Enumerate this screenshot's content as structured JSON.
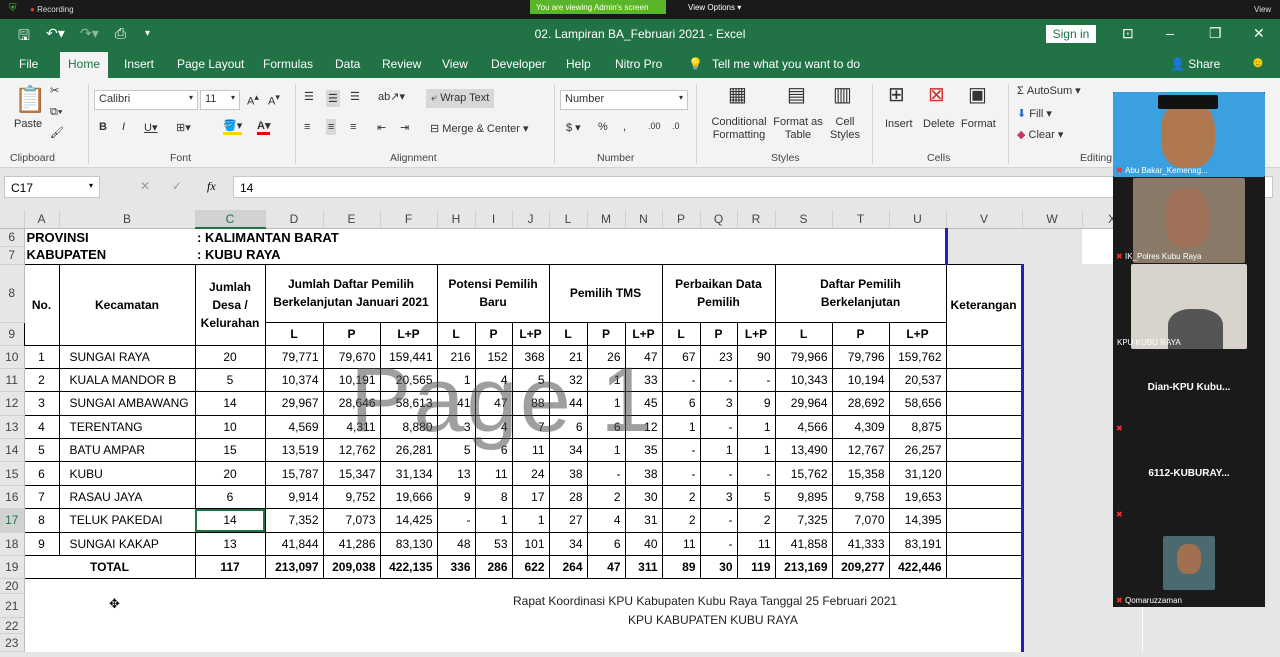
{
  "zoom": {
    "recording": "Recording",
    "viewing": "You are viewing Admin's screen",
    "view_options": "View Options",
    "view": "View"
  },
  "window": {
    "title": "02. Lampiran BA_Februari 2021  -  Excel",
    "sign_in": "Sign in"
  },
  "tabs": [
    "File",
    "Home",
    "Insert",
    "Page Layout",
    "Formulas",
    "Data",
    "Review",
    "View",
    "Developer",
    "Help",
    "Nitro Pro"
  ],
  "tell_me": "Tell me what you want to do",
  "share": "Share",
  "ribbon": {
    "paste": "Paste",
    "clipboard": "Clipboard",
    "font_name": "Calibri",
    "font_size": "11",
    "font": "Font",
    "wrap_text": "Wrap Text",
    "merge_center": "Merge & Center",
    "alignment": "Alignment",
    "number_format": "Number",
    "number": "Number",
    "conditional": "Conditional Formatting",
    "format_table": "Format as Table",
    "cell_styles": "Cell Styles",
    "styles": "Styles",
    "insert": "Insert",
    "delete": "Delete",
    "format": "Format",
    "cells": "Cells",
    "autosum": "AutoSum",
    "fill": "Fill",
    "clear": "Clear",
    "editing": "Editing"
  },
  "formula_bar": {
    "name_box": "C17",
    "value": "14"
  },
  "columns": [
    "A",
    "B",
    "C",
    "D",
    "E",
    "F",
    "H",
    "I",
    "J",
    "L",
    "M",
    "N",
    "P",
    "Q",
    "R",
    "S",
    "T",
    "U",
    "V",
    "W",
    "X"
  ],
  "selected_column": "C",
  "selected_row": "17",
  "sheet": {
    "provinsi_label": "PROVINSI",
    "provinsi_value": ": KALIMANTAN BARAT",
    "kabupaten_label": "KABUPATEN",
    "kabupaten_value": ": KUBU RAYA",
    "headers": {
      "no": "No.",
      "kecamatan": "Kecamatan",
      "jumlah_desa": "Jumlah Desa / Kelurahan",
      "dpb_jan": "Jumlah Daftar Pemilih Berkelanjutan Januari 2021",
      "potensi": "Potensi Pemilih Baru",
      "tms": "Pemilih TMS",
      "perbaikan": "Perbaikan Data Pemilih",
      "dpb": "Daftar Pemilih Berkelanjutan",
      "keterangan": "Keterangan",
      "l": "L",
      "p": "P",
      "lp": "L+P"
    },
    "rows": [
      [
        "1",
        "SUNGAI RAYA",
        "20",
        "79,771",
        "79,670",
        "159,441",
        "216",
        "152",
        "368",
        "21",
        "26",
        "47",
        "67",
        "23",
        "90",
        "79,966",
        "79,796",
        "159,762"
      ],
      [
        "2",
        "KUALA MANDOR B",
        "5",
        "10,374",
        "10,191",
        "20,565",
        "1",
        "4",
        "5",
        "32",
        "1",
        "33",
        "-",
        "-",
        "-",
        "10,343",
        "10,194",
        "20,537"
      ],
      [
        "3",
        "SUNGAI AMBAWANG",
        "14",
        "29,967",
        "28,646",
        "58,613",
        "41",
        "47",
        "88",
        "44",
        "1",
        "45",
        "6",
        "3",
        "9",
        "29,964",
        "28,692",
        "58,656"
      ],
      [
        "4",
        "TERENTANG",
        "10",
        "4,569",
        "4,311",
        "8,880",
        "3",
        "4",
        "7",
        "6",
        "6",
        "12",
        "1",
        "-",
        "1",
        "4,566",
        "4,309",
        "8,875"
      ],
      [
        "5",
        "BATU AMPAR",
        "15",
        "13,519",
        "12,762",
        "26,281",
        "5",
        "6",
        "11",
        "34",
        "1",
        "35",
        "-",
        "1",
        "1",
        "13,490",
        "12,767",
        "26,257"
      ],
      [
        "6",
        "KUBU",
        "20",
        "15,787",
        "15,347",
        "31,134",
        "13",
        "11",
        "24",
        "38",
        "-",
        "38",
        "-",
        "-",
        "-",
        "15,762",
        "15,358",
        "31,120"
      ],
      [
        "7",
        "RASAU JAYA",
        "6",
        "9,914",
        "9,752",
        "19,666",
        "9",
        "8",
        "17",
        "28",
        "2",
        "30",
        "2",
        "3",
        "5",
        "9,895",
        "9,758",
        "19,653"
      ],
      [
        "8",
        "TELUK PAKEDAI",
        "14",
        "7,352",
        "7,073",
        "14,425",
        "-",
        "1",
        "1",
        "27",
        "4",
        "31",
        "2",
        "-",
        "2",
        "7,325",
        "7,070",
        "14,395"
      ],
      [
        "9",
        "SUNGAI KAKAP",
        "13",
        "41,844",
        "41,286",
        "83,130",
        "48",
        "53",
        "101",
        "34",
        "6",
        "40",
        "11",
        "-",
        "11",
        "41,858",
        "41,333",
        "83,191"
      ]
    ],
    "total": [
      "TOTAL",
      "117",
      "213,097",
      "209,038",
      "422,135",
      "336",
      "286",
      "622",
      "264",
      "47",
      "311",
      "89",
      "30",
      "119",
      "213,169",
      "209,277",
      "422,446"
    ],
    "footer_line1": "Rapat Koordinasi KPU Kabupaten Kubu Raya Tanggal 25 Februari 2021",
    "footer_line2": "KPU KABUPATEN KUBU RAYA",
    "watermark": "Page 1"
  },
  "participants": [
    "Abu Bakar_Kemenag...",
    "IK_Polres Kubu Raya",
    "KPU KUBU RAYA",
    "Dian-KPU  Kubu...",
    "6112-KUBURAY...",
    "Qomaruzzaman"
  ],
  "colors": {
    "excel_green": "#217346",
    "zoom_green": "#5ab52a",
    "page_break": "#2222bb"
  }
}
